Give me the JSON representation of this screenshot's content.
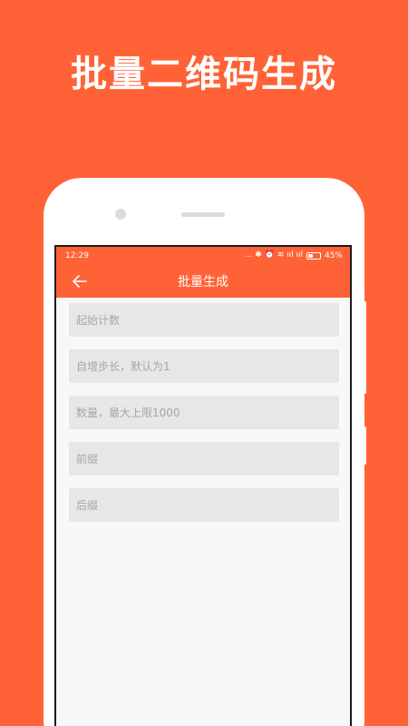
{
  "promo": {
    "headline": "批量二维码生成"
  },
  "status_bar": {
    "time": "12:29",
    "indicators": "... ✱ ⏰ ≋ ııl ııl",
    "battery_percent": 45,
    "battery_label": "45%"
  },
  "app_bar": {
    "back_icon": "arrow-left-icon",
    "title": "批量生成"
  },
  "form": {
    "fields": [
      {
        "placeholder": "起始计数",
        "value": ""
      },
      {
        "placeholder": "自增步长，默认为1",
        "value": ""
      },
      {
        "placeholder": "数量，最大上限1000",
        "value": ""
      },
      {
        "placeholder": "前缀",
        "value": ""
      },
      {
        "placeholder": "后缀",
        "value": ""
      }
    ]
  },
  "colors": {
    "brand": "#FF6236",
    "field_bg": "#E7E7E9",
    "placeholder": "#A6A6A6",
    "screen_bg": "#F8F8FA"
  }
}
